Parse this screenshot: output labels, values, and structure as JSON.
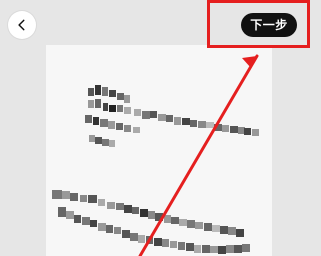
{
  "header": {
    "next_label": "下一步"
  },
  "colors": {
    "background": "#e6e6e6",
    "button_dark": "#111111",
    "highlight": "#e51f1f",
    "card": "#f7f7f7"
  },
  "icons": {
    "back": "chevron-left-icon"
  }
}
